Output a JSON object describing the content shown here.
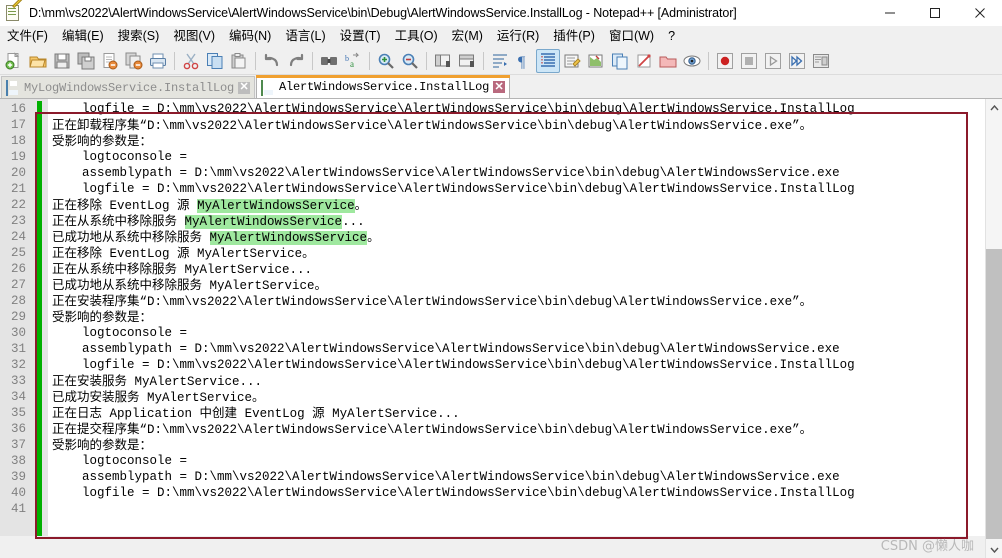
{
  "window": {
    "title": "D:\\mm\\vs2022\\AlertWindowsService\\AlertWindowsService\\bin\\Debug\\AlertWindowsService.InstallLog - Notepad++ [Administrator]",
    "icon": "notepad-plus-plus-icon",
    "minimize_label": "─",
    "maximize_label": "□",
    "close_label": "✕"
  },
  "menu": {
    "items": [
      {
        "label": "文件(F)",
        "name": "menu-file"
      },
      {
        "label": "编辑(E)",
        "name": "menu-edit"
      },
      {
        "label": "搜索(S)",
        "name": "menu-search"
      },
      {
        "label": "视图(V)",
        "name": "menu-view"
      },
      {
        "label": "编码(N)",
        "name": "menu-encoding"
      },
      {
        "label": "语言(L)",
        "name": "menu-language"
      },
      {
        "label": "设置(T)",
        "name": "menu-settings"
      },
      {
        "label": "工具(O)",
        "name": "menu-tools"
      },
      {
        "label": "宏(M)",
        "name": "menu-macro"
      },
      {
        "label": "运行(R)",
        "name": "menu-run"
      },
      {
        "label": "插件(P)",
        "name": "menu-plugins"
      },
      {
        "label": "窗口(W)",
        "name": "menu-window"
      },
      {
        "label": "?",
        "name": "menu-help"
      }
    ]
  },
  "toolbar": {
    "buttons": [
      {
        "name": "new-file-icon",
        "kind": "new"
      },
      {
        "name": "open-file-icon",
        "kind": "open"
      },
      {
        "name": "save-icon",
        "kind": "save"
      },
      {
        "name": "save-all-icon",
        "kind": "saveall"
      },
      {
        "name": "close-file-icon",
        "kind": "close"
      },
      {
        "name": "close-all-files-icon",
        "kind": "closeall"
      },
      {
        "name": "print-icon",
        "kind": "print"
      },
      {
        "name": "separator",
        "kind": "sep"
      },
      {
        "name": "cut-icon",
        "kind": "cut"
      },
      {
        "name": "copy-icon",
        "kind": "copy"
      },
      {
        "name": "paste-icon",
        "kind": "paste"
      },
      {
        "name": "separator",
        "kind": "sep"
      },
      {
        "name": "undo-icon",
        "kind": "undo"
      },
      {
        "name": "redo-icon",
        "kind": "redo"
      },
      {
        "name": "separator",
        "kind": "sep"
      },
      {
        "name": "find-icon",
        "kind": "find"
      },
      {
        "name": "replace-icon",
        "kind": "replace"
      },
      {
        "name": "separator",
        "kind": "sep"
      },
      {
        "name": "zoom-in-icon",
        "kind": "zoomin"
      },
      {
        "name": "zoom-out-icon",
        "kind": "zoomout"
      },
      {
        "name": "separator",
        "kind": "sep"
      },
      {
        "name": "sync-vertical-scroll-icon",
        "kind": "syncv"
      },
      {
        "name": "sync-horizontal-scroll-icon",
        "kind": "synch"
      },
      {
        "name": "separator",
        "kind": "sep"
      },
      {
        "name": "word-wrap-icon",
        "kind": "wrap"
      },
      {
        "name": "show-all-characters-icon",
        "kind": "pilcrow"
      },
      {
        "name": "indent-guide-icon",
        "kind": "indentguide",
        "active": true
      },
      {
        "name": "user-defined-language-icon",
        "kind": "udl"
      },
      {
        "name": "show-document-map-icon",
        "kind": "docmap"
      },
      {
        "name": "function-list-icon",
        "kind": "funclist"
      },
      {
        "name": "document-switcher-icon",
        "kind": "docswitch"
      },
      {
        "name": "folder-as-workspace-icon",
        "kind": "folderws"
      },
      {
        "name": "monitoring-icon",
        "kind": "monitor"
      },
      {
        "name": "separator",
        "kind": "sep"
      },
      {
        "name": "record-macro-icon",
        "kind": "record"
      },
      {
        "name": "stop-recording-icon",
        "kind": "stop"
      },
      {
        "name": "play-macro-icon",
        "kind": "play"
      },
      {
        "name": "run-macro-multiple-icon",
        "kind": "playmulti"
      },
      {
        "name": "run-icon",
        "kind": "run"
      }
    ]
  },
  "tabs": [
    {
      "label": "MyLogWindowsService.InstallLog",
      "active": false,
      "close_label": "✕",
      "icon": "blue-disk-icon"
    },
    {
      "label": "AlertWindowsService.InstallLog",
      "active": true,
      "close_label": "✕",
      "icon": "green-disk-icon"
    }
  ],
  "editor": {
    "first_line_number": 16,
    "highlight_token": "MyAlertWindowsService",
    "lines": [
      {
        "n": 16,
        "segs": [
          {
            "t": "    logfile = D:\\mm\\vs2022\\AlertWindowsService\\AlertWindowsService\\bin\\debug\\AlertWindowsService.InstallLog",
            "s": "underline"
          }
        ]
      },
      {
        "n": 17,
        "segs": [
          {
            "t": "正在卸载程序集",
            "s": "cjk"
          },
          {
            "t": "“D:\\mm\\vs2022\\AlertWindowsService\\AlertWindowsService\\bin\\debug\\AlertWindowsService.exe”",
            "s": ""
          },
          {
            "t": "。",
            "s": "cjk"
          }
        ]
      },
      {
        "n": 18,
        "segs": [
          {
            "t": "受影响的参数是：",
            "s": "cjk"
          }
        ]
      },
      {
        "n": 19,
        "segs": [
          {
            "t": "    logtoconsole =",
            "s": ""
          }
        ]
      },
      {
        "n": 20,
        "segs": [
          {
            "t": "    assemblypath = D:\\mm\\vs2022\\AlertWindowsService\\AlertWindowsService\\bin\\debug\\AlertWindowsService.exe",
            "s": ""
          }
        ]
      },
      {
        "n": 21,
        "segs": [
          {
            "t": "    logfile = D:\\mm\\vs2022\\AlertWindowsService\\AlertWindowsService\\bin\\debug\\AlertWindowsService.InstallLog",
            "s": ""
          }
        ]
      },
      {
        "n": 22,
        "segs": [
          {
            "t": "正在移除",
            "s": "cjk"
          },
          {
            "t": " EventLog ",
            "s": ""
          },
          {
            "t": "源",
            "s": "cjk"
          },
          {
            "t": " ",
            "s": ""
          },
          {
            "t": "MyAlertWindowsService",
            "s": "hl"
          },
          {
            "t": "。",
            "s": "cjk"
          }
        ]
      },
      {
        "n": 23,
        "segs": [
          {
            "t": "正在从系统中移除服务",
            "s": "cjk"
          },
          {
            "t": " ",
            "s": ""
          },
          {
            "t": "MyAlertWindowsService",
            "s": "hl"
          },
          {
            "t": "...",
            "s": ""
          }
        ]
      },
      {
        "n": 24,
        "segs": [
          {
            "t": "已成功地从系统中移除服务",
            "s": "cjk"
          },
          {
            "t": " ",
            "s": ""
          },
          {
            "t": "MyAlertWindowsService",
            "s": "hl"
          },
          {
            "t": "。",
            "s": "cjk"
          }
        ]
      },
      {
        "n": 25,
        "segs": [
          {
            "t": "正在移除",
            "s": "cjk"
          },
          {
            "t": " EventLog ",
            "s": ""
          },
          {
            "t": "源",
            "s": "cjk"
          },
          {
            "t": " MyAlertService",
            "s": ""
          },
          {
            "t": "。",
            "s": "cjk"
          }
        ]
      },
      {
        "n": 26,
        "segs": [
          {
            "t": "正在从系统中移除服务",
            "s": "cjk"
          },
          {
            "t": " MyAlertService...",
            "s": ""
          }
        ]
      },
      {
        "n": 27,
        "segs": [
          {
            "t": "已成功地从系统中移除服务",
            "s": "cjk"
          },
          {
            "t": " MyAlertService",
            "s": ""
          },
          {
            "t": "。",
            "s": "cjk"
          }
        ]
      },
      {
        "n": 28,
        "segs": [
          {
            "t": "正在安装程序集",
            "s": "cjk"
          },
          {
            "t": "“D:\\mm\\vs2022\\AlertWindowsService\\AlertWindowsService\\bin\\debug\\AlertWindowsService.exe”",
            "s": ""
          },
          {
            "t": "。",
            "s": "cjk"
          }
        ]
      },
      {
        "n": 29,
        "segs": [
          {
            "t": "受影响的参数是：",
            "s": "cjk"
          }
        ]
      },
      {
        "n": 30,
        "segs": [
          {
            "t": "    logtoconsole =",
            "s": ""
          }
        ]
      },
      {
        "n": 31,
        "segs": [
          {
            "t": "    assemblypath = D:\\mm\\vs2022\\AlertWindowsService\\AlertWindowsService\\bin\\debug\\AlertWindowsService.exe",
            "s": ""
          }
        ]
      },
      {
        "n": 32,
        "segs": [
          {
            "t": "    logfile = D:\\mm\\vs2022\\AlertWindowsService\\AlertWindowsService\\bin\\debug\\AlertWindowsService.InstallLog",
            "s": ""
          }
        ]
      },
      {
        "n": 33,
        "segs": [
          {
            "t": "正在安装服务",
            "s": "cjk"
          },
          {
            "t": " MyAlertService...",
            "s": ""
          }
        ]
      },
      {
        "n": 34,
        "segs": [
          {
            "t": "已成功安装服务",
            "s": "cjk"
          },
          {
            "t": " MyAlertService",
            "s": ""
          },
          {
            "t": "。",
            "s": "cjk"
          }
        ]
      },
      {
        "n": 35,
        "segs": [
          {
            "t": "正在日志",
            "s": "cjk"
          },
          {
            "t": " Application ",
            "s": ""
          },
          {
            "t": "中创建",
            "s": "cjk"
          },
          {
            "t": " EventLog ",
            "s": ""
          },
          {
            "t": "源",
            "s": "cjk"
          },
          {
            "t": " MyAlertService...",
            "s": ""
          }
        ]
      },
      {
        "n": 36,
        "segs": [
          {
            "t": "正在提交程序集",
            "s": "cjk"
          },
          {
            "t": "“D:\\mm\\vs2022\\AlertWindowsService\\AlertWindowsService\\bin\\debug\\AlertWindowsService.exe”",
            "s": ""
          },
          {
            "t": "。",
            "s": "cjk"
          }
        ]
      },
      {
        "n": 37,
        "segs": [
          {
            "t": "受影响的参数是：",
            "s": "cjk"
          }
        ]
      },
      {
        "n": 38,
        "segs": [
          {
            "t": "    logtoconsole =",
            "s": ""
          }
        ]
      },
      {
        "n": 39,
        "segs": [
          {
            "t": "    assemblypath = D:\\mm\\vs2022\\AlertWindowsService\\AlertWindowsService\\bin\\debug\\AlertWindowsService.exe",
            "s": ""
          }
        ]
      },
      {
        "n": 40,
        "segs": [
          {
            "t": "    logfile = D:\\mm\\vs2022\\AlertWindowsService\\AlertWindowsService\\bin\\debug\\AlertWindowsService.InstallLog",
            "s": ""
          }
        ]
      },
      {
        "n": 41,
        "segs": []
      }
    ]
  },
  "annotation": {
    "color": "#8b1a2b",
    "name": "red-highlight-rectangle"
  },
  "scrollbar": {
    "up_arrow": "▲",
    "down_arrow": "▼"
  },
  "watermark": {
    "text": "CSDN @懒人咖"
  },
  "colors": {
    "highlight_green": "#9fe89f",
    "change_bar_green": "#00b000",
    "active_tab_accent": "#f0a030",
    "annotation_red": "#8b1a2b"
  }
}
